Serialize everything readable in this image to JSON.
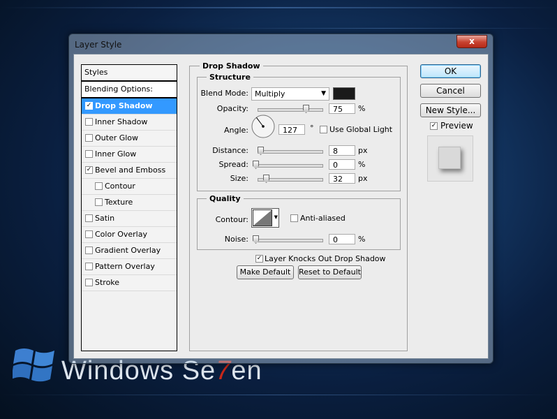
{
  "dialog": {
    "title": "Layer Style",
    "close_glyph": "x"
  },
  "styles_panel": {
    "header": "Styles",
    "blending": "Blending Options: Custom",
    "items": [
      {
        "label": "Drop Shadow",
        "checked": true,
        "selected": true,
        "sub": false
      },
      {
        "label": "Inner Shadow",
        "checked": false,
        "selected": false,
        "sub": false
      },
      {
        "label": "Outer Glow",
        "checked": false,
        "selected": false,
        "sub": false
      },
      {
        "label": "Inner Glow",
        "checked": false,
        "selected": false,
        "sub": false
      },
      {
        "label": "Bevel and Emboss",
        "checked": true,
        "selected": false,
        "sub": false
      },
      {
        "label": "Contour",
        "checked": false,
        "selected": false,
        "sub": true
      },
      {
        "label": "Texture",
        "checked": false,
        "selected": false,
        "sub": true
      },
      {
        "label": "Satin",
        "checked": false,
        "selected": false,
        "sub": false
      },
      {
        "label": "Color Overlay",
        "checked": false,
        "selected": false,
        "sub": false
      },
      {
        "label": "Gradient Overlay",
        "checked": false,
        "selected": false,
        "sub": false
      },
      {
        "label": "Pattern Overlay",
        "checked": false,
        "selected": false,
        "sub": false
      },
      {
        "label": "Stroke",
        "checked": false,
        "selected": false,
        "sub": false
      }
    ]
  },
  "drop_shadow": {
    "title": "Drop Shadow",
    "structure": {
      "title": "Structure",
      "blend_mode_label": "Blend Mode:",
      "blend_mode_value": "Multiply",
      "shadow_color": "#1a1a1a",
      "opacity_label": "Opacity:",
      "opacity_value": "75",
      "percent": "%",
      "angle_label": "Angle:",
      "angle_value": "127",
      "degree": "°",
      "use_global_light_label": "Use Global Light",
      "use_global_light_checked": false,
      "distance_label": "Distance:",
      "distance_value": "8",
      "spread_label": "Spread:",
      "spread_value": "0",
      "size_label": "Size:",
      "size_value": "32",
      "px": "px"
    },
    "quality": {
      "title": "Quality",
      "contour_label": "Contour:",
      "anti_aliased_label": "Anti-aliased",
      "anti_aliased_checked": false,
      "noise_label": "Noise:",
      "noise_value": "0",
      "percent": "%"
    },
    "layer_knocks_out_label": "Layer Knocks Out Drop Shadow",
    "layer_knocks_out_checked": true,
    "make_default_label": "Make Default",
    "reset_default_label": "Reset to Default"
  },
  "buttons": {
    "ok": "OK",
    "cancel": "Cancel",
    "new_style": "New Style..."
  },
  "preview": {
    "label": "Preview",
    "checked": true
  },
  "desktop": {
    "logo_text_1": "Windows Se",
    "logo_text_7": "7",
    "logo_text_2": "en"
  }
}
